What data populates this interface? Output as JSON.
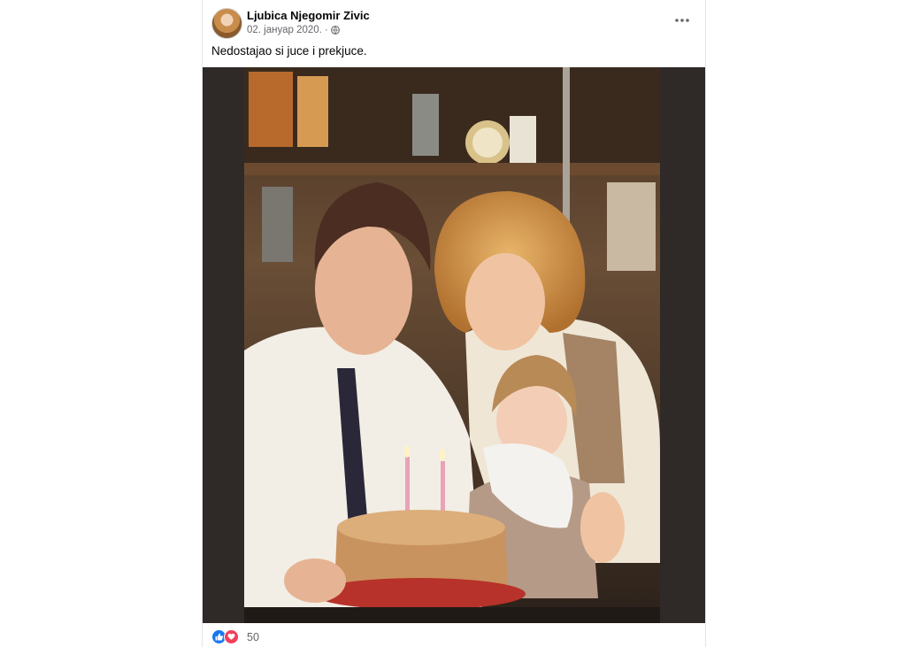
{
  "post": {
    "author": "Ljubica Njegomir Zivic",
    "date": "02. јануар 2020.",
    "separator": "·",
    "audience_icon": "globe-icon",
    "more_icon": "more-horizontal-icon",
    "text": "Nedostajao si juce i prekjuce.",
    "photo_description": "Vintage family photo: a man in a white shirt and dark tie, a blonde woman in a cream blouse, and a small child at a birthday cake with lit candles",
    "reactions": {
      "icons": [
        "like-icon",
        "love-icon"
      ],
      "count": "50",
      "like_color": "#1877f2",
      "love_color": "#f33e58"
    }
  }
}
